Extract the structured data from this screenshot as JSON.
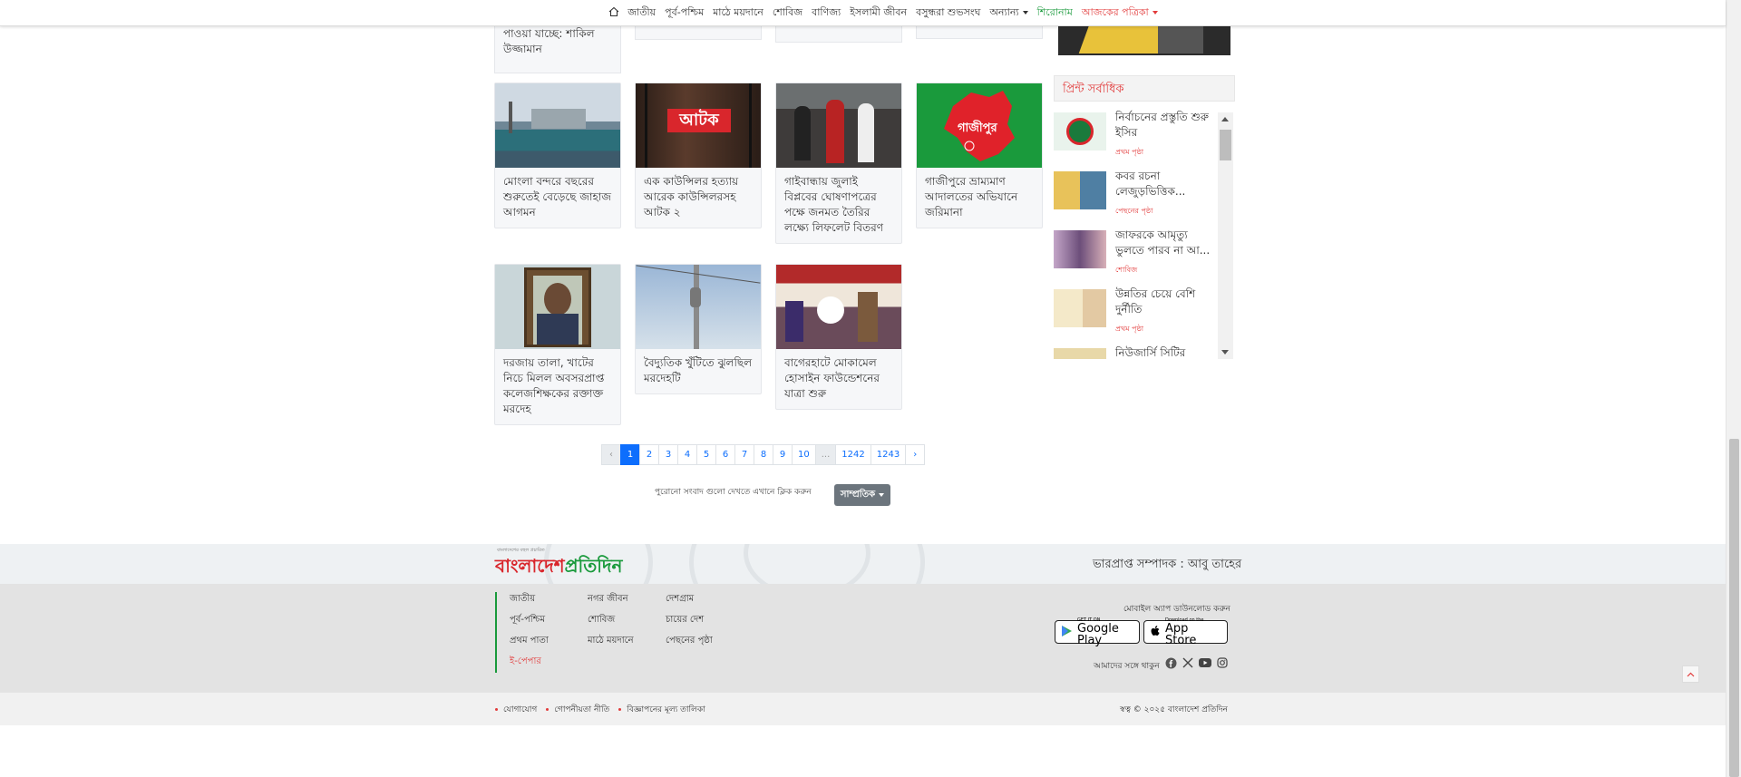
{
  "nav": {
    "home_icon": "home-icon",
    "items": [
      "জাতীয়",
      "পূর্ব-পশ্চিম",
      "মাঠে ময়দানে",
      "শোবিজ",
      "বাণিজ্য",
      "ইসলামী জীবন",
      "বসুন্ধরা শুভসংঘ",
      "অন্যান্য",
      "শিরোনাম",
      "আজকের পত্রিকা"
    ]
  },
  "top_fragments": {
    "first_title": "পাওয়া যাচ্ছে: শাকিল উজ্জামান"
  },
  "news": [
    {
      "title": "মোংলা বন্দরে বছরের শুরুতেই  বেড়েছে জাহাজ আগমন"
    },
    {
      "title": "এক কাউন্সিলর হত্যায় আরেক কাউন্সিলরসহ আটক ২",
      "overlay": "আটক"
    },
    {
      "title": "গাইবান্ধায় জুলাই বিপ্লবের ঘোষণাপত্রের পক্ষে জনমত তৈরির লক্ষ্যে লিফলেট বিতরণ"
    },
    {
      "title": "গাজীপুরে ভ্রাম্যমাণ আদালতের অভিযানে জরিমানা",
      "overlay": "গাজীপুর"
    },
    {
      "title": "দরজায় তালা, খাটের নিচে মিলল অবসরপ্রাপ্ত কলেজশিক্ষকের রক্তাক্ত মরদেহ"
    },
    {
      "title": "বৈদ্যুতিক খুঁটিতে ঝুলছিল মরদেহটি"
    },
    {
      "title": "বাগেরহাটে মোকামেল হোসাইন ফাউন্ডেশনের যাত্রা শুরু"
    }
  ],
  "sidebar": {
    "heading": "প্রিন্ট সর্বাধিক",
    "items": [
      {
        "title": "নির্বাচনের প্রস্তুতি শুরু ইসির",
        "category": "প্রথম পৃষ্ঠা"
      },
      {
        "title": "কবর রচনা লেজুড়ভিত্তিক...",
        "category": "পেছনের পৃষ্ঠা"
      },
      {
        "title": "জাফরকে আমৃত্যু ভুলতে পারব না আ...",
        "category": "শোবিজ"
      },
      {
        "title": "উন্নতির চেয়ে বেশি দুর্নীতি",
        "category": "প্রথম পৃষ্ঠা"
      },
      {
        "title": "নিউজার্সি সিটির",
        "category": ""
      }
    ]
  },
  "pagination": {
    "prev": "‹",
    "pages": [
      "1",
      "2",
      "3",
      "4",
      "5",
      "6",
      "7",
      "8",
      "9",
      "10",
      "...",
      "1242",
      "1243"
    ],
    "next": "›",
    "active": "1"
  },
  "archive": {
    "text": "পুরোনো সংবাদ গুলো দেখতে এখানে ক্লিক করুন",
    "button": "সাম্প্রতিক"
  },
  "footer": {
    "logo_a": "বাংলাদেশ",
    "logo_b": "প্রতিদিন",
    "logo_tag": "বাংলাদেশের বহুল প্রচারিত",
    "editor": "ভারপ্রাপ্ত সম্পাদক : আবু তাহের",
    "col1": [
      "জাতীয়",
      "পূর্ব-পশ্চিম",
      "প্রথম পাতা",
      "ই-পেপার"
    ],
    "col2": [
      "নগর জীবন",
      "শোবিজ",
      "মাঠে ময়দানে"
    ],
    "col3": [
      "দেশগ্রাম",
      "চায়ের দেশ",
      "পেছনের পৃষ্ঠা"
    ],
    "app_label": "মোবাইল অ্যাপ ডাউনলোড করুন",
    "google_small": "GET IT ON",
    "google_big": "Google Play",
    "apple_small": "Download on the",
    "apple_big": "App Store",
    "social_label": "আমাদের সঙ্গে থাকুন",
    "social_icons": [
      "facebook-icon",
      "x-icon",
      "youtube-icon",
      "instagram-icon"
    ],
    "bottom_links": [
      "যোগাযোগ",
      "গোপনীয়তা নীতি",
      "বিজ্ঞাপনের মূল্য তালিকা"
    ],
    "copyright": "স্বত্ব © ২০২৫ বাংলাদেশ প্রতিদিন"
  },
  "colors": {
    "brand_red": "#d9262c",
    "brand_green": "#1a9a3c",
    "link_blue": "#0d6efd"
  }
}
